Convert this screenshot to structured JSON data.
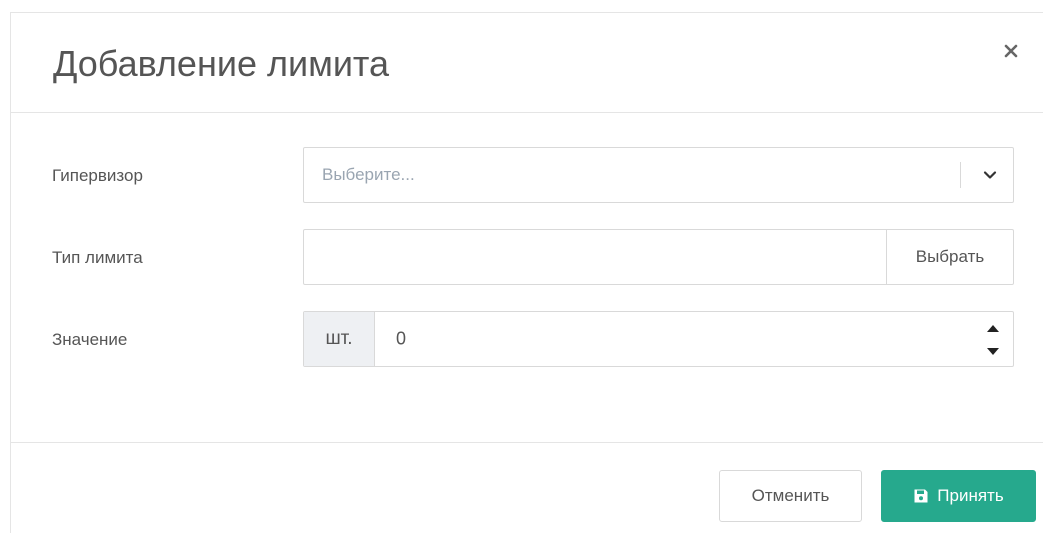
{
  "modal": {
    "title": "Добавление лимита",
    "close_icon": "close-icon"
  },
  "form": {
    "hypervisor": {
      "label": "Гипервизор",
      "placeholder": "Выберите...",
      "icon": "chevron-down-icon"
    },
    "limit_type": {
      "label": "Тип лимита",
      "value": "",
      "button_label": "Выбрать"
    },
    "value": {
      "label": "Значение",
      "unit": "шт.",
      "number": "0",
      "icons": [
        "caret-up-icon",
        "caret-down-icon"
      ]
    }
  },
  "footer": {
    "cancel_label": "Отменить",
    "accept_label": "Принять",
    "accept_icon": "save-icon"
  },
  "colors": {
    "accent": "#26a98d",
    "border": "#d9d9d9",
    "addon_bg": "#eef0f3",
    "placeholder": "#9aa5b1"
  }
}
